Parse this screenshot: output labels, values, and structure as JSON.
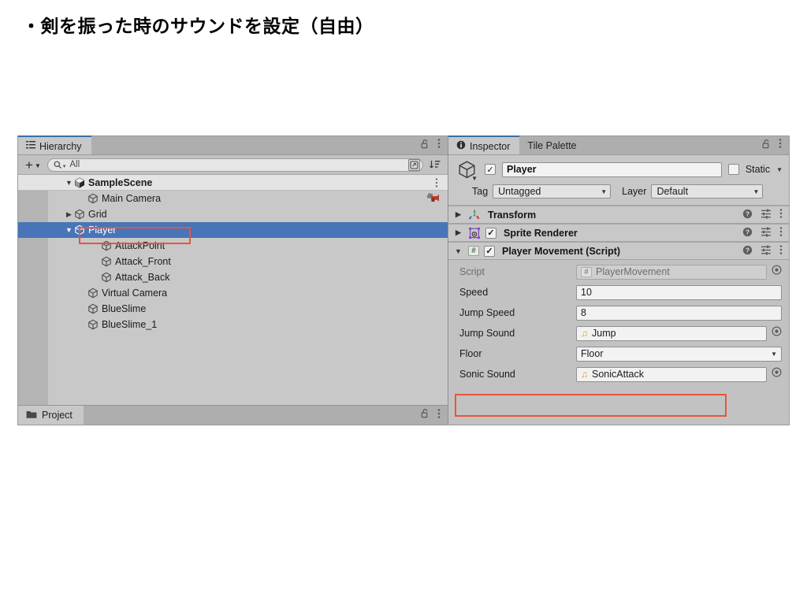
{
  "slide": {
    "title": "・剣を振った時のサウンドを設定（自由）"
  },
  "hierarchy": {
    "tab_label": "Hierarchy",
    "tab_icon": "hierarchy-icon",
    "lock_icon": "lock-open-icon",
    "menu_icon": "kebab-menu-icon",
    "toolbar": {
      "create_label": "+",
      "create_caret": "▼",
      "search_placeholder": "All",
      "search_icon": "search-icon",
      "picker_icon": "object-picker-icon",
      "sort_icon": "sort-icon"
    },
    "scene": {
      "name": "SampleScene",
      "expanded": true,
      "twirl": "▼",
      "icon": "unity-scene-icon",
      "menu_icon": "kebab-menu-icon"
    },
    "items": [
      {
        "name": "Main Camera",
        "indent": 2,
        "twirl": "",
        "icon": "gameobject-cube-icon",
        "selected": false,
        "right_icon": "cinemachine-icon"
      },
      {
        "name": "Grid",
        "indent": 1,
        "twirl": "▶",
        "icon": "gameobject-cube-icon",
        "selected": false,
        "right_icon": ""
      },
      {
        "name": "Player",
        "indent": 1,
        "twirl": "▼",
        "icon": "gameobject-cube-icon",
        "selected": true,
        "right_icon": ""
      },
      {
        "name": "AttackPoint",
        "indent": 3,
        "twirl": "",
        "icon": "gameobject-cube-icon",
        "selected": false,
        "right_icon": ""
      },
      {
        "name": "Attack_Front",
        "indent": 3,
        "twirl": "",
        "icon": "gameobject-cube-icon",
        "selected": false,
        "right_icon": ""
      },
      {
        "name": "Attack_Back",
        "indent": 3,
        "twirl": "",
        "icon": "gameobject-cube-icon",
        "selected": false,
        "right_icon": ""
      },
      {
        "name": "Virtual Camera",
        "indent": 2,
        "twirl": "",
        "icon": "gameobject-cube-icon",
        "selected": false,
        "right_icon": ""
      },
      {
        "name": "BlueSlime",
        "indent": 2,
        "twirl": "",
        "icon": "gameobject-cube-icon",
        "selected": false,
        "right_icon": ""
      },
      {
        "name": "BlueSlime_1",
        "indent": 2,
        "twirl": "",
        "icon": "gameobject-cube-icon",
        "selected": false,
        "right_icon": ""
      }
    ]
  },
  "project": {
    "tab_label": "Project",
    "tab_icon": "folder-icon",
    "lock_icon": "lock-open-icon",
    "menu_icon": "kebab-menu-icon"
  },
  "inspector": {
    "tabs": [
      {
        "label": "Inspector",
        "icon": "info-icon",
        "active": true
      },
      {
        "label": "Tile Palette",
        "icon": "",
        "active": false
      }
    ],
    "lock_icon": "lock-open-icon",
    "menu_icon": "kebab-menu-icon",
    "object": {
      "icon": "gameobject-cube-icon",
      "enabled_check": "✓",
      "name": "Player",
      "static_label": "Static",
      "static_checked": false,
      "tag_label": "Tag",
      "tag_value": "Untagged",
      "layer_label": "Layer",
      "layer_value": "Default"
    },
    "components": [
      {
        "title": "Transform",
        "icon": "transform-axes-icon",
        "twirl": "▶",
        "expanded": false,
        "has_enable_checkbox": false,
        "enabled": false,
        "help_icon": "help-icon",
        "preset_icon": "preset-sliders-icon",
        "menu_icon": "kebab-menu-icon"
      },
      {
        "title": "Sprite Renderer",
        "icon": "sprite-renderer-icon",
        "twirl": "▶",
        "expanded": false,
        "has_enable_checkbox": true,
        "enabled": true,
        "help_icon": "help-icon",
        "preset_icon": "preset-sliders-icon",
        "menu_icon": "kebab-menu-icon"
      },
      {
        "title": "Player Movement (Script)",
        "icon": "csharp-script-icon",
        "twirl": "▼",
        "expanded": true,
        "has_enable_checkbox": true,
        "enabled": true,
        "help_icon": "help-icon",
        "preset_icon": "preset-sliders-icon",
        "menu_icon": "kebab-menu-icon"
      }
    ],
    "script_properties": [
      {
        "label": "Script",
        "value": "PlayerMovement",
        "kind": "object",
        "icon": "csharp-script-icon",
        "disabled": true,
        "picker": true,
        "highlighted": false
      },
      {
        "label": "Speed",
        "value": "10",
        "kind": "text",
        "icon": "",
        "disabled": false,
        "picker": false,
        "highlighted": false
      },
      {
        "label": "Jump Speed",
        "value": "8",
        "kind": "text",
        "icon": "",
        "disabled": false,
        "picker": false,
        "highlighted": false
      },
      {
        "label": "Jump Sound",
        "value": "Jump",
        "kind": "object",
        "icon": "audio-clip-icon",
        "disabled": false,
        "picker": true,
        "highlighted": false
      },
      {
        "label": "Floor",
        "value": "Floor",
        "kind": "dropdown",
        "icon": "",
        "disabled": false,
        "picker": false,
        "highlighted": false
      },
      {
        "label": "Sonic Sound",
        "value": "SonicAttack",
        "kind": "object",
        "icon": "audio-clip-icon",
        "disabled": false,
        "picker": true,
        "highlighted": true
      }
    ]
  },
  "annotations": {
    "color": "#e8553a",
    "targets": [
      "hierarchy-player-row",
      "inspector-sonic-sound-row"
    ]
  }
}
